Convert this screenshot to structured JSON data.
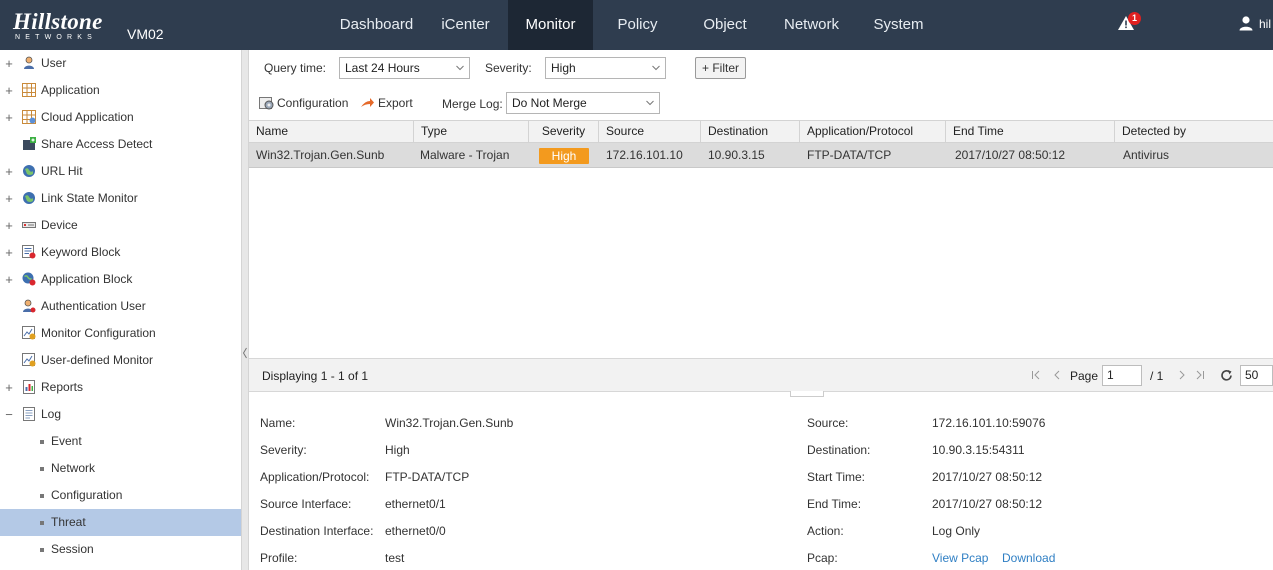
{
  "header": {
    "brand": "Hillstone",
    "brand_sub": "NETWORKS",
    "device": "VM02",
    "nav": [
      "Dashboard",
      "iCenter",
      "Monitor",
      "Policy",
      "Object",
      "Network",
      "System"
    ],
    "active_nav": "Monitor",
    "alert_count": "1",
    "user": "hil"
  },
  "sidebar": {
    "items": [
      {
        "label": "User",
        "icon": "user-icon",
        "expand": "+"
      },
      {
        "label": "Application",
        "icon": "application-grid-icon",
        "expand": "+"
      },
      {
        "label": "Cloud Application",
        "icon": "cloud-application-icon",
        "expand": "+"
      },
      {
        "label": "Share Access Detect",
        "icon": "share-access-icon",
        "expand": ""
      },
      {
        "label": "URL Hit",
        "icon": "globe-icon",
        "expand": "+"
      },
      {
        "label": "Link State Monitor",
        "icon": "globe-icon",
        "expand": "+"
      },
      {
        "label": "Device",
        "icon": "device-icon",
        "expand": "+"
      },
      {
        "label": "Keyword Block",
        "icon": "keyword-block-icon",
        "expand": "+"
      },
      {
        "label": "Application Block",
        "icon": "globe-block-icon",
        "expand": "+"
      },
      {
        "label": "Authentication User",
        "icon": "auth-user-icon",
        "expand": ""
      },
      {
        "label": "Monitor Configuration",
        "icon": "monitor-config-icon",
        "expand": ""
      },
      {
        "label": "User-defined Monitor",
        "icon": "monitor-config-icon",
        "expand": ""
      },
      {
        "label": "Reports",
        "icon": "report-icon",
        "expand": "+"
      },
      {
        "label": "Log",
        "icon": "log-icon",
        "expand": "−"
      }
    ],
    "log_children": [
      "Event",
      "Network",
      "Configuration",
      "Threat",
      "Session"
    ],
    "selected": "Threat"
  },
  "query": {
    "time_label": "Query time:",
    "time_value": "Last 24 Hours",
    "severity_label": "Severity:",
    "severity_value": "High",
    "filter_label": "+ Filter"
  },
  "toolbar": {
    "configuration": "Configuration",
    "export": "Export",
    "merge_label": "Merge Log:",
    "merge_value": "Do Not Merge"
  },
  "grid": {
    "columns": [
      "Name",
      "Type",
      "Severity",
      "Source",
      "Destination",
      "Application/Protocol",
      "End Time",
      "Detected by"
    ],
    "rows": [
      {
        "name": "Win32.Trojan.Gen.Sunb",
        "type": "Malware - Trojan",
        "severity": "High",
        "source": "172.16.101.10",
        "destination": "10.90.3.15",
        "app": "FTP-DATA/TCP",
        "end_time": "2017/10/27 08:50:12",
        "detected_by": "Antivirus"
      }
    ]
  },
  "paging": {
    "displaying": "Displaying 1 - 1 of 1",
    "page_label": "Page",
    "page": "1",
    "total": "/ 1",
    "page_size": "50"
  },
  "detail": {
    "left": [
      {
        "label": "Name:",
        "value": "Win32.Trojan.Gen.Sunb"
      },
      {
        "label": "Severity:",
        "value": "High"
      },
      {
        "label": "Application/Protocol:",
        "value": "FTP-DATA/TCP"
      },
      {
        "label": "Source Interface:",
        "value": "ethernet0/1"
      },
      {
        "label": "Destination Interface:",
        "value": "ethernet0/0"
      },
      {
        "label": "Profile:",
        "value": "test"
      }
    ],
    "right": [
      {
        "label": "Source:",
        "value": "172.16.101.10:59076"
      },
      {
        "label": "Destination:",
        "value": "10.90.3.15:54311"
      },
      {
        "label": "Start Time:",
        "value": "2017/10/27 08:50:12"
      },
      {
        "label": "End Time:",
        "value": "2017/10/27 08:50:12"
      },
      {
        "label": "Action:",
        "value": "Log Only"
      }
    ],
    "pcap_label": "Pcap:",
    "view_pcap": "View Pcap",
    "download": "Download"
  },
  "colors": {
    "topbar": "#2f3d4f",
    "active_nav": "#1d2734",
    "selected_row": "#b4c9e6",
    "severity_high": "#f39a1e",
    "link": "#2f7fc4"
  }
}
